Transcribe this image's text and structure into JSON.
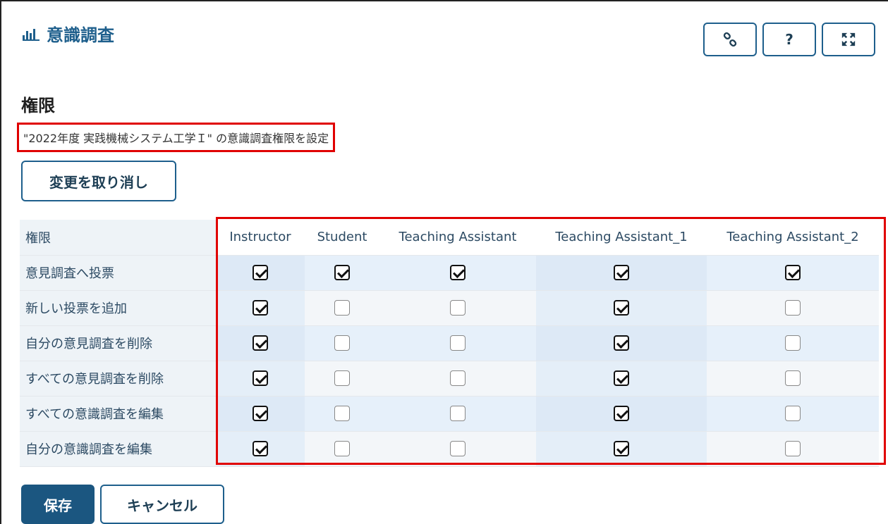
{
  "header": {
    "title": "意識調査",
    "icon": "bar-chart-icon",
    "accent_color": "#1e5f8c"
  },
  "toolbar": {
    "link_icon": "link-icon",
    "help_label": "?",
    "expand_icon": "expand-icon"
  },
  "section": {
    "title": "権限",
    "subtitle": "\"2022年度 実践機械システム工学Ｉ\" の意識調査権限を設定"
  },
  "revert_label": "変更を取り消し",
  "table": {
    "header_label": "権限",
    "roles": [
      "Instructor",
      "Student",
      "Teaching Assistant",
      "Teaching Assistant_1",
      "Teaching Assistant_2"
    ],
    "rows": [
      {
        "label": "意見調査へ投票",
        "values": [
          true,
          true,
          true,
          true,
          true
        ]
      },
      {
        "label": "新しい投票を追加",
        "values": [
          true,
          false,
          false,
          true,
          false
        ]
      },
      {
        "label": "自分の意見調査を削除",
        "values": [
          true,
          false,
          false,
          true,
          false
        ]
      },
      {
        "label": "すべての意見調査を削除",
        "values": [
          true,
          false,
          false,
          true,
          false
        ]
      },
      {
        "label": "すべての意識調査を編集",
        "values": [
          true,
          false,
          false,
          true,
          false
        ]
      },
      {
        "label": "自分の意識調査を編集",
        "values": [
          true,
          false,
          false,
          true,
          false
        ]
      }
    ]
  },
  "footer": {
    "save_label": "保存",
    "cancel_label": "キャンセル",
    "save_color": "#1b5680"
  }
}
